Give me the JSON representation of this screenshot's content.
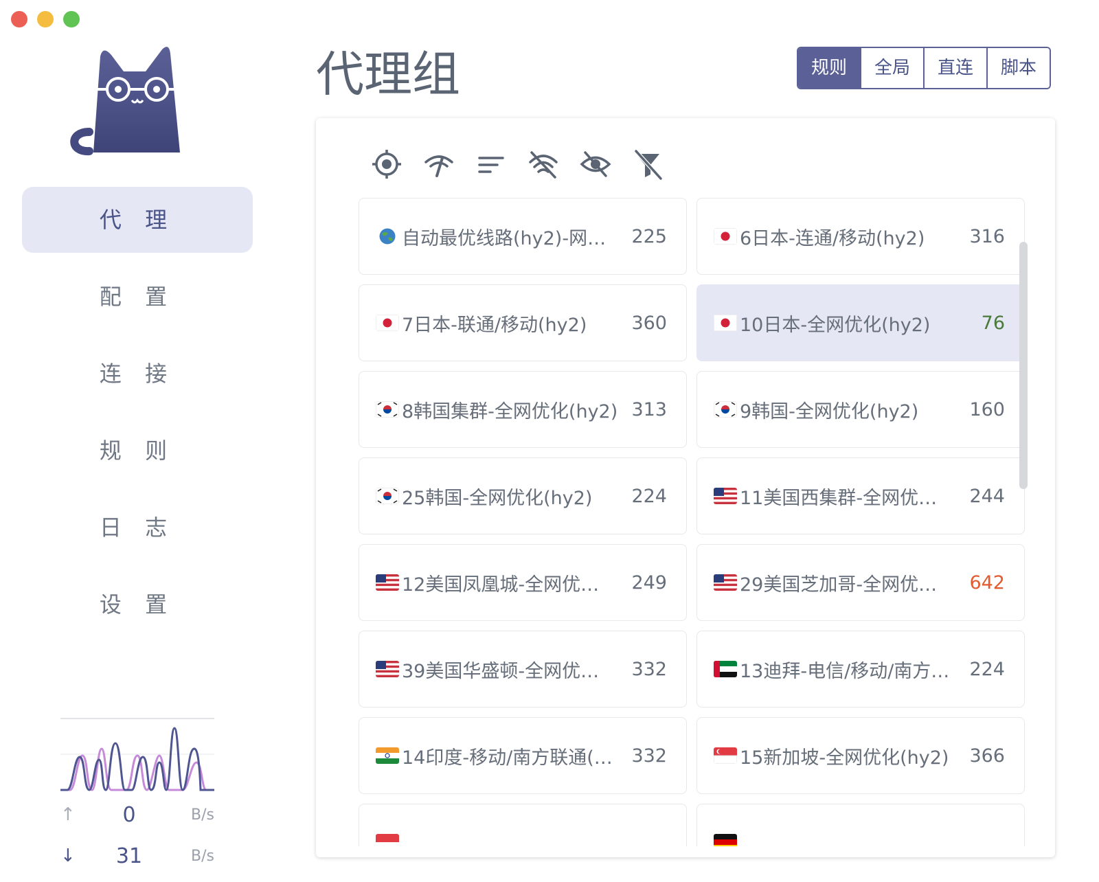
{
  "sidebar": {
    "nav": [
      {
        "label": "代 理",
        "active": true
      },
      {
        "label": "配 置"
      },
      {
        "label": "连 接"
      },
      {
        "label": "规 则"
      },
      {
        "label": "日 志"
      },
      {
        "label": "设 置"
      }
    ],
    "upload": {
      "value": "0",
      "unit": "B/s"
    },
    "download": {
      "value": "31",
      "unit": "B/s"
    }
  },
  "header": {
    "title": "代理组",
    "modes": [
      {
        "label": "规则",
        "active": true
      },
      {
        "label": "全局"
      },
      {
        "label": "直连"
      },
      {
        "label": "脚本"
      }
    ]
  },
  "toolbar": {
    "icons": [
      "locate-icon",
      "speed-test-icon",
      "sort-icon",
      "hide-unavailable-icon",
      "hide-icon",
      "filter-off-icon"
    ]
  },
  "proxies": [
    {
      "flag": "globe",
      "name": "自动最优线路(hy2)-网…",
      "delay": "225",
      "status": "normal"
    },
    {
      "flag": "jp",
      "name": "6日本-连通/移动(hy2)",
      "delay": "316",
      "status": "normal"
    },
    {
      "flag": "jp",
      "name": "7日本-联通/移动(hy2)",
      "delay": "360",
      "status": "normal"
    },
    {
      "flag": "jp",
      "name": "10日本-全网优化(hy2)",
      "delay": "76",
      "status": "good",
      "selected": true
    },
    {
      "flag": "kr",
      "name": "8韩国集群-全网优化(hy2)",
      "delay": "313",
      "status": "normal"
    },
    {
      "flag": "kr",
      "name": "9韩国-全网优化(hy2)",
      "delay": "160",
      "status": "normal"
    },
    {
      "flag": "kr",
      "name": "25韩国-全网优化(hy2)",
      "delay": "224",
      "status": "normal"
    },
    {
      "flag": "us",
      "name": "11美国西集群-全网优…",
      "delay": "244",
      "status": "normal"
    },
    {
      "flag": "us",
      "name": "12美国凤凰城-全网优…",
      "delay": "249",
      "status": "normal"
    },
    {
      "flag": "us",
      "name": "29美国芝加哥-全网优…",
      "delay": "642",
      "status": "bad"
    },
    {
      "flag": "us",
      "name": "39美国华盛顿-全网优…",
      "delay": "332",
      "status": "normal"
    },
    {
      "flag": "ae",
      "name": "13迪拜-电信/移动/南方…",
      "delay": "224",
      "status": "normal"
    },
    {
      "flag": "in",
      "name": "14印度-移动/南方联通(…",
      "delay": "332",
      "status": "normal"
    },
    {
      "flag": "sg",
      "name": "15新加坡-全网优化(hy2)",
      "delay": "366",
      "status": "normal"
    },
    {
      "flag": "sg",
      "name": "",
      "delay": "",
      "status": "normal"
    },
    {
      "flag": "de",
      "name": "",
      "delay": "",
      "status": "normal"
    }
  ],
  "colors": {
    "accent": "#5b6197",
    "good": "#4a7a3a",
    "bad": "#e35a2f"
  }
}
